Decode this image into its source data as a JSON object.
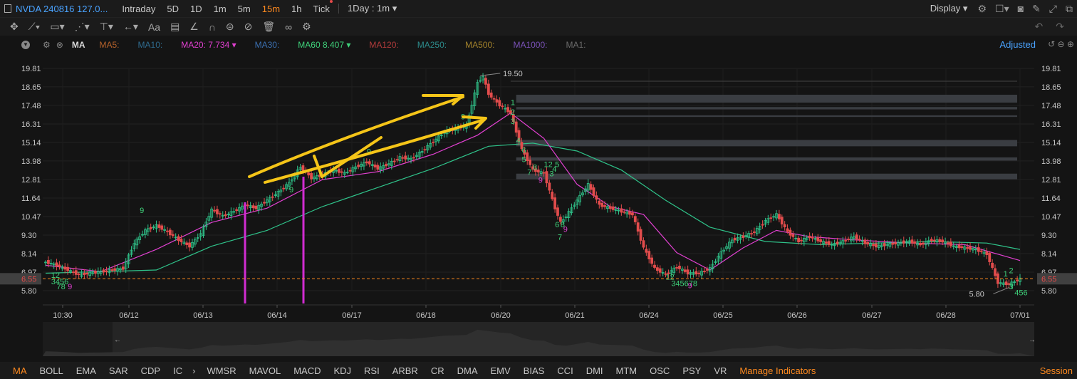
{
  "header": {
    "symbol": "NVDA 240816 127.0...",
    "timeframes": [
      "Intraday",
      "5D",
      "1D",
      "1m",
      "5m",
      "15m",
      "1h",
      "Tick"
    ],
    "active_timeframe": "15m",
    "range_select": "1Day : 1m ▾",
    "display_label": "Display ▾"
  },
  "ma_bar": {
    "label": "MA",
    "items": [
      {
        "text": "MA5:",
        "color": "#b5622b"
      },
      {
        "text": "MA10:",
        "color": "#2f6b8e"
      },
      {
        "text": "MA20: 7.734 ▾",
        "color": "#e040d0"
      },
      {
        "text": "MA30:",
        "color": "#3b6fb0"
      },
      {
        "text": "MA60 8.407 ▾",
        "color": "#3fd17a"
      },
      {
        "text": "MA120:",
        "color": "#b23b3b"
      },
      {
        "text": "MA250:",
        "color": "#2d8b8b"
      },
      {
        "text": "MA500:",
        "color": "#a3822b"
      },
      {
        "text": "MA1000:",
        "color": "#7a52b8"
      },
      {
        "text": "MA1:",
        "color": "#6b6b6b"
      }
    ],
    "adjusted": "Adjusted"
  },
  "chart_data": {
    "type": "candlestick",
    "y_ticks": [
      "19.81",
      "18.65",
      "17.48",
      "16.31",
      "15.14",
      "13.98",
      "12.81",
      "11.64",
      "10.47",
      "9.30",
      "8.14",
      "6.97",
      "5.80"
    ],
    "current_price": "6.55",
    "x_labels": [
      "10:30",
      "06/12",
      "06/13",
      "06/14",
      "06/17",
      "06/18",
      "06/20",
      "06/21",
      "06/24",
      "06/25",
      "06/26",
      "06/27",
      "06/28",
      "07/01"
    ],
    "high_label": "19.50",
    "low_label": "5.80",
    "ylim": [
      5.8,
      19.81
    ],
    "price_path": [
      [
        0,
        7.6
      ],
      [
        2,
        7.4
      ],
      [
        4,
        7.1
      ],
      [
        6,
        6.8
      ],
      [
        8,
        6.9
      ],
      [
        10,
        7.0
      ],
      [
        12,
        7.1
      ],
      [
        14,
        7.2
      ],
      [
        16,
        8.8
      ],
      [
        18,
        9.6
      ],
      [
        20,
        9.9
      ],
      [
        22,
        9.5
      ],
      [
        24,
        9.0
      ],
      [
        26,
        8.6
      ],
      [
        28,
        9.4
      ],
      [
        30,
        10.9
      ],
      [
        32,
        10.5
      ],
      [
        34,
        10.8
      ],
      [
        36,
        11.2
      ],
      [
        38,
        11.0
      ],
      [
        40,
        11.5
      ],
      [
        42,
        12.0
      ],
      [
        44,
        12.6
      ],
      [
        46,
        13.6
      ],
      [
        48,
        12.9
      ],
      [
        50,
        13.1
      ],
      [
        52,
        13.4
      ],
      [
        54,
        13.2
      ],
      [
        56,
        13.6
      ],
      [
        58,
        13.9
      ],
      [
        60,
        13.5
      ],
      [
        62,
        13.8
      ],
      [
        64,
        14.2
      ],
      [
        66,
        14.1
      ],
      [
        68,
        14.6
      ],
      [
        70,
        15.2
      ],
      [
        72,
        15.8
      ],
      [
        74,
        16.0
      ],
      [
        76,
        16.2
      ],
      [
        78,
        18.9
      ],
      [
        79,
        19.3
      ],
      [
        80,
        18.2
      ],
      [
        82,
        17.5
      ],
      [
        84,
        17.0
      ],
      [
        85,
        15.8
      ],
      [
        86,
        14.7
      ],
      [
        88,
        13.4
      ],
      [
        90,
        13.2
      ],
      [
        92,
        11.0
      ],
      [
        93,
        10.1
      ],
      [
        94,
        10.5
      ],
      [
        96,
        11.5
      ],
      [
        98,
        12.5
      ],
      [
        100,
        11.2
      ],
      [
        102,
        11.0
      ],
      [
        104,
        10.8
      ],
      [
        106,
        10.6
      ],
      [
        108,
        8.5
      ],
      [
        110,
        7.2
      ],
      [
        112,
        6.8
      ],
      [
        114,
        7.3
      ],
      [
        116,
        6.9
      ],
      [
        118,
        6.9
      ],
      [
        120,
        7.2
      ],
      [
        122,
        8.2
      ],
      [
        124,
        9.0
      ],
      [
        126,
        9.2
      ],
      [
        128,
        9.5
      ],
      [
        130,
        10.2
      ],
      [
        132,
        10.6
      ],
      [
        134,
        9.5
      ],
      [
        136,
        8.9
      ],
      [
        138,
        9.2
      ],
      [
        140,
        8.9
      ],
      [
        142,
        8.7
      ],
      [
        144,
        8.9
      ],
      [
        146,
        9.2
      ],
      [
        148,
        8.8
      ],
      [
        150,
        8.6
      ],
      [
        152,
        8.7
      ],
      [
        154,
        8.8
      ],
      [
        156,
        8.9
      ],
      [
        158,
        8.7
      ],
      [
        160,
        9.0
      ],
      [
        162,
        8.9
      ],
      [
        164,
        8.6
      ],
      [
        166,
        8.5
      ],
      [
        168,
        8.4
      ],
      [
        170,
        8.1
      ],
      [
        172,
        6.3
      ],
      [
        174,
        6.2
      ],
      [
        176,
        6.55
      ]
    ],
    "ma20_path": [
      [
        0,
        7.4
      ],
      [
        10,
        7.0
      ],
      [
        20,
        8.4
      ],
      [
        30,
        10.1
      ],
      [
        40,
        11.0
      ],
      [
        50,
        12.8
      ],
      [
        60,
        13.3
      ],
      [
        70,
        14.4
      ],
      [
        78,
        15.6
      ],
      [
        84,
        17.0
      ],
      [
        90,
        15.4
      ],
      [
        96,
        12.5
      ],
      [
        102,
        11.1
      ],
      [
        108,
        10.6
      ],
      [
        114,
        8.2
      ],
      [
        120,
        7.1
      ],
      [
        126,
        8.5
      ],
      [
        132,
        9.6
      ],
      [
        138,
        9.2
      ],
      [
        146,
        9.0
      ],
      [
        156,
        8.8
      ],
      [
        166,
        8.7
      ],
      [
        176,
        7.7
      ]
    ],
    "ma60_path": [
      [
        0,
        6.9
      ],
      [
        20,
        7.1
      ],
      [
        30,
        8.6
      ],
      [
        40,
        9.6
      ],
      [
        50,
        11.1
      ],
      [
        60,
        12.3
      ],
      [
        70,
        13.5
      ],
      [
        80,
        14.9
      ],
      [
        88,
        15.1
      ],
      [
        96,
        14.6
      ],
      [
        104,
        13.4
      ],
      [
        112,
        11.5
      ],
      [
        120,
        9.8
      ],
      [
        130,
        8.9
      ],
      [
        140,
        8.7
      ],
      [
        150,
        8.8
      ],
      [
        160,
        8.9
      ],
      [
        170,
        8.8
      ],
      [
        176,
        8.4
      ]
    ],
    "sequence_counts": [
      {
        "text": "9",
        "x": 17,
        "y": 10.7,
        "color": "#3fd17a"
      },
      {
        "text": "9",
        "x": 44,
        "y": 12.0,
        "color": "#3fd17a"
      },
      {
        "text": "9",
        "x": 58,
        "y": 14.4,
        "color": "#3fd17a"
      },
      {
        "text": "9",
        "x": 75,
        "y": 16.6,
        "color": "#3fd17a"
      },
      {
        "text": "1",
        "x": 84,
        "y": 17.5,
        "color": "#3fd17a"
      },
      {
        "text": "2",
        "x": 84,
        "y": 16.9,
        "color": "#3fd17a"
      },
      {
        "text": "3",
        "x": 84,
        "y": 16.3,
        "color": "#3fd17a"
      },
      {
        "text": "4",
        "x": 85,
        "y": 15.1,
        "color": "#3fd17a"
      },
      {
        "text": "6",
        "x": 86,
        "y": 14.5,
        "color": "#3fd17a"
      },
      {
        "text": "5",
        "x": 86,
        "y": 13.9,
        "color": "#3fd17a"
      },
      {
        "text": "8",
        "x": 88,
        "y": 13.4,
        "color": "#3fd17a"
      },
      {
        "text": "7",
        "x": 87,
        "y": 13.1,
        "color": "#3fd17a"
      },
      {
        "text": "12",
        "x": 90,
        "y": 13.6,
        "color": "#3fd17a"
      },
      {
        "text": "3",
        "x": 91,
        "y": 13.0,
        "color": "#3fd17a"
      },
      {
        "text": "4",
        "x": 91.5,
        "y": 13.3,
        "color": "#3fd17a"
      },
      {
        "text": "5",
        "x": 92,
        "y": 13.6,
        "color": "#3fd17a"
      },
      {
        "text": "9",
        "x": 89,
        "y": 12.6,
        "color": "#e040d0"
      },
      {
        "text": "6",
        "x": 92,
        "y": 9.8,
        "color": "#3fd17a"
      },
      {
        "text": "8",
        "x": 93,
        "y": 9.8,
        "color": "#3fd17a"
      },
      {
        "text": "9",
        "x": 93.5,
        "y": 9.5,
        "color": "#e040d0"
      },
      {
        "text": "7",
        "x": 92.5,
        "y": 9.0,
        "color": "#3fd17a"
      },
      {
        "text": "12",
        "x": 112,
        "y": 6.5,
        "color": "#3fd17a"
      },
      {
        "text": "345678",
        "x": 113,
        "y": 6.1,
        "color": "#3fd17a"
      },
      {
        "text": "9",
        "x": 116,
        "y": 5.95,
        "color": "#e040d0"
      },
      {
        "text": "12",
        "x": 1,
        "y": 6.6,
        "color": "#3fd17a"
      },
      {
        "text": "3456",
        "x": 1,
        "y": 6.2,
        "color": "#3fd17a"
      },
      {
        "text": "78",
        "x": 2,
        "y": 5.9,
        "color": "#3fd17a"
      },
      {
        "text": "9",
        "x": 4,
        "y": 5.9,
        "color": "#e040d0"
      },
      {
        "text": "3",
        "x": 174,
        "y": 5.9,
        "color": "#3fd17a"
      },
      {
        "text": "456",
        "x": 175,
        "y": 5.5,
        "color": "#3fd17a"
      },
      {
        "text": "1",
        "x": 173,
        "y": 6.7,
        "color": "#3fd17a"
      },
      {
        "text": "2",
        "x": 174,
        "y": 6.9,
        "color": "#3fd17a"
      }
    ],
    "resistance_bands": [
      {
        "y": 17.9,
        "h": 0.5
      },
      {
        "y": 17.3,
        "h": 0.15
      },
      {
        "y": 16.8,
        "h": 0.1
      },
      {
        "y": 15.1,
        "h": 0.4
      },
      {
        "y": 14.1,
        "h": 0.2
      },
      {
        "y": 13.0,
        "h": 0.35
      }
    ]
  },
  "bottom_bar": {
    "indicators": [
      "MA",
      "BOLL",
      "EMA",
      "SAR",
      "CDP",
      "IC",
      "WMSR",
      "MAVOL",
      "MACD",
      "KDJ",
      "RSI",
      "ARBR",
      "CR",
      "DMA",
      "EMV",
      "BIAS",
      "CCI",
      "DMI",
      "MTM",
      "OSC",
      "PSY",
      "VR"
    ],
    "active_indicator": "MA",
    "manage": "Manage Indicators",
    "session": "Session"
  },
  "colors": {
    "up": "#e24c4c",
    "down": "#2fc38a",
    "accent": "#ff8a1f",
    "link": "#4aa3ff",
    "annotation": "#f5c518",
    "vertical": "#d12cd1"
  }
}
